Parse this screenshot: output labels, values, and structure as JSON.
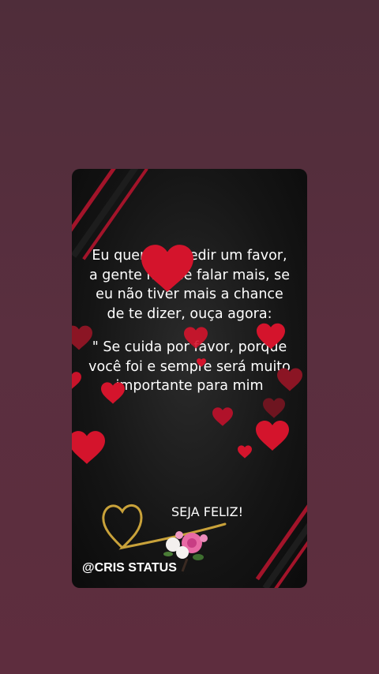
{
  "card": {
    "quote_part1": "Eu queria te pedir um favor, a gente não se falar mais, se eu não tiver mais a chance de te dizer, ouça agora:",
    "quote_part2": "\" Se cuida por favor, porque você foi e sempre será muito importante para mim",
    "closing": "SEJA FELIZ!",
    "watermark": "@CRIS STATUS"
  },
  "colors": {
    "background": "#552e3d",
    "card": "#151515",
    "heart": "#d4142c",
    "stripe": "#a3142a",
    "gold": "#c9a23a"
  },
  "icons": [
    "heart-icon",
    "gold-heart-icon",
    "flower-bouquet-icon"
  ]
}
